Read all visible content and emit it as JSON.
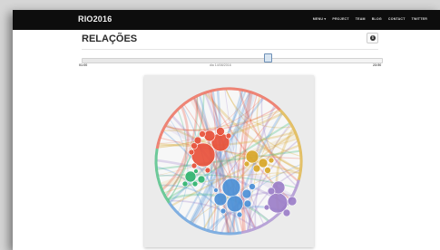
{
  "navbar": {
    "brand": "RIO2016",
    "links": [
      "MENU ▾",
      "PROJECT",
      "TEAM",
      "BLOG",
      "CONTACT",
      "TWITTER"
    ]
  },
  "page": {
    "title": "RELAÇÕES"
  },
  "timeline": {
    "start_label": "01:00",
    "current_label": "dia 14/08/2016",
    "end_label": "23:50",
    "position": 0.62
  },
  "colors": {
    "navbar": "#0d0d0d",
    "red": "#e8503a",
    "gold": "#d8a628",
    "green": "#2fb36f",
    "blue": "#4b8fd6",
    "purple": "#9b7ec8"
  }
}
